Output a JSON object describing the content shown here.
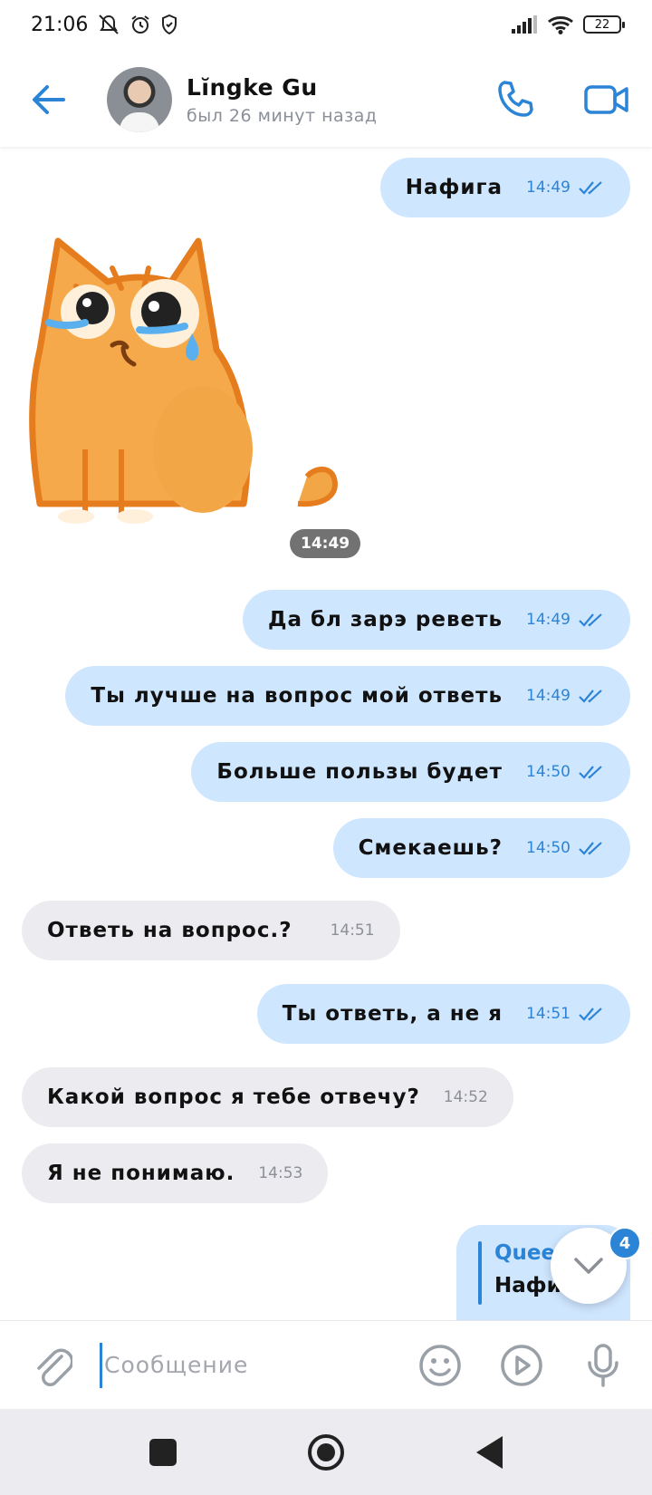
{
  "status_bar": {
    "time": "21:06",
    "battery": "22"
  },
  "header": {
    "contact_name": "Lĭngke Gu",
    "contact_status": "был 26 минут назад"
  },
  "colors": {
    "accent": "#2b84d6",
    "outgoing_bubble": "#cfe6ff",
    "incoming_bubble": "#ececf0"
  },
  "messages": [
    {
      "direction": "out",
      "text": "Нафига",
      "time": "14:49",
      "read": true
    },
    {
      "direction": "in",
      "type": "sticker",
      "sticker": "crying-cat",
      "time": "14:49"
    },
    {
      "direction": "out",
      "text": "Да бл зарэ реветь",
      "time": "14:49",
      "read": true
    },
    {
      "direction": "out",
      "text": "Ты лучше на вопрос мой ответь",
      "time": "14:49",
      "read": true
    },
    {
      "direction": "out",
      "text": "Больше пользы будет",
      "time": "14:50",
      "read": true
    },
    {
      "direction": "out",
      "text": "Смекаешь?",
      "time": "14:50",
      "read": true
    },
    {
      "direction": "in",
      "text": "Ответь на вопрос.?",
      "time": "14:51"
    },
    {
      "direction": "out",
      "text": "Ты ответь, а не я",
      "time": "14:51",
      "read": true
    },
    {
      "direction": "in",
      "text": "Какой вопрос я тебе отвечу?",
      "time": "14:52"
    },
    {
      "direction": "in",
      "text": "Я не понимаю.",
      "time": "14:53"
    }
  ],
  "partial_reply": {
    "author": "Quee",
    "text": "Нафиг"
  },
  "scroll_down": {
    "unread_count": "4"
  },
  "composer": {
    "placeholder": "Сообщение",
    "value": ""
  }
}
